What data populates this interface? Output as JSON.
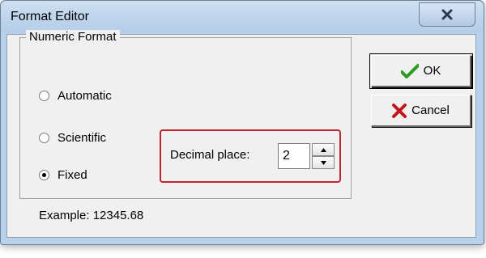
{
  "window": {
    "title": "Format Editor"
  },
  "group": {
    "legend": "Numeric Format"
  },
  "options": [
    {
      "label": "Automatic",
      "selected": false
    },
    {
      "label": "Scientific",
      "selected": false
    },
    {
      "label": "Fixed",
      "selected": true
    }
  ],
  "decimal": {
    "label": "Decimal place:",
    "value": "2"
  },
  "example": {
    "text": "Example:  12345.68"
  },
  "buttons": {
    "ok": "OK",
    "cancel": "Cancel"
  },
  "colors": {
    "highlight": "#c0242c",
    "ok_check": "#2e9a20",
    "cancel_x": "#c0181a"
  }
}
